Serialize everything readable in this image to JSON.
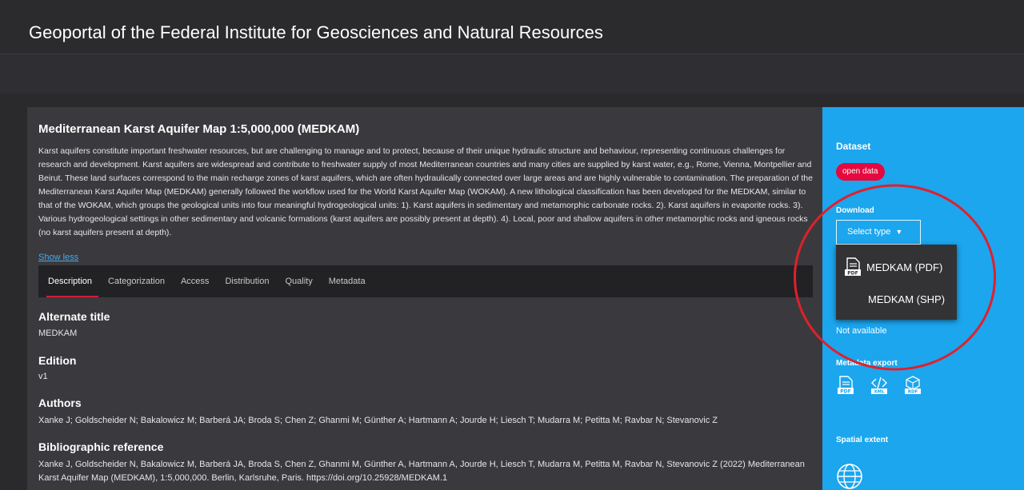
{
  "portal": {
    "title": "Geoportal of the Federal Institute for Geosciences and Natural Resources"
  },
  "dataset": {
    "title": "Mediterranean Karst Aquifer Map 1:5,000,000 (MEDKAM)",
    "abstract": "Karst aquifers constitute important freshwater resources, but are challenging to manage and to protect, because of their unique hydraulic structure and behaviour, representing continuous challenges for research and development. Karst aquifers are widespread and contribute to freshwater supply of most Mediterranean countries and many cities are supplied by karst water, e.g., Rome, Vienna, Montpellier and Beirut. These land surfaces correspond to the main recharge zones of karst aquifers, which are often hydraulically connected over large areas and are highly vulnerable to contamination. The preparation of the Mediterranean Karst Aquifer Map (MEDKAM) generally followed the workflow used for the World Karst Aquifer Map (WOKAM). A new lithological classification has been developed for the MEDKAM, similar to that of the WOKAM, which groups the geological units into four meaningful hydrogeological units: 1). Karst aquifers in sedimentary and metamorphic carbonate rocks. 2). Karst aquifers in evaporite rocks. 3). Various hydrogeological settings in other sedimentary and volcanic formations (karst aquifers are possibly present at depth). 4). Local, poor and shallow aquifers in other metamorphic rocks and igneous rocks (no karst aquifers present at depth).",
    "show_less": "Show less"
  },
  "tabs": [
    "Description",
    "Categorization",
    "Access",
    "Distribution",
    "Quality",
    "Metadata"
  ],
  "description": {
    "alternate_title_label": "Alternate title",
    "alternate_title": "MEDKAM",
    "edition_label": "Edition",
    "edition": "v1",
    "authors_label": "Authors",
    "authors": "Xanke J; Goldscheider N; Bakalowicz M; Barberá JA; Broda S; Chen Z; Ghanmi M; Günther A; Hartmann A; Jourde H; Liesch T; Mudarra M; Petitta M; Ravbar N; Stevanovic Z",
    "bib_label": "Bibliographic reference",
    "bib": "Xanke J, Goldscheider N, Bakalowicz M, Barberá JA, Broda S, Chen Z, Ghanmi M, Günther A, Hartmann A, Jourde H, Liesch T, Mudarra M, Petitta M, Ravbar N, Stevanovic Z (2022) Mediterranean Karst Aquifer Map (MEDKAM), 1:5,000,000. Berlin, Karlsruhe, Paris. https://doi.org/10.25928/MEDKAM.1"
  },
  "sidebar": {
    "dataset_label": "Dataset",
    "badge": "open data",
    "download_label": "Download",
    "select_label": "Select type",
    "not_available": "Not available",
    "metadata_export_label": "Metadata export",
    "export_icons": [
      "pdf-icon",
      "xml-icon",
      "rdf-icon"
    ],
    "export_icon_labels": [
      "PDF",
      "XML",
      "RDF"
    ],
    "spatial_extent_label": "Spatial extent",
    "accent_color": "#1ba6ee",
    "badge_color": "#e4093e"
  },
  "dropdown": {
    "items": [
      {
        "label": "MEDKAM (PDF)",
        "icon": "pdf-file-icon"
      },
      {
        "label": "MEDKAM (SHP)",
        "icon": ""
      }
    ]
  },
  "annotation": {
    "color": "#e0202a",
    "shape": "ellipse"
  }
}
